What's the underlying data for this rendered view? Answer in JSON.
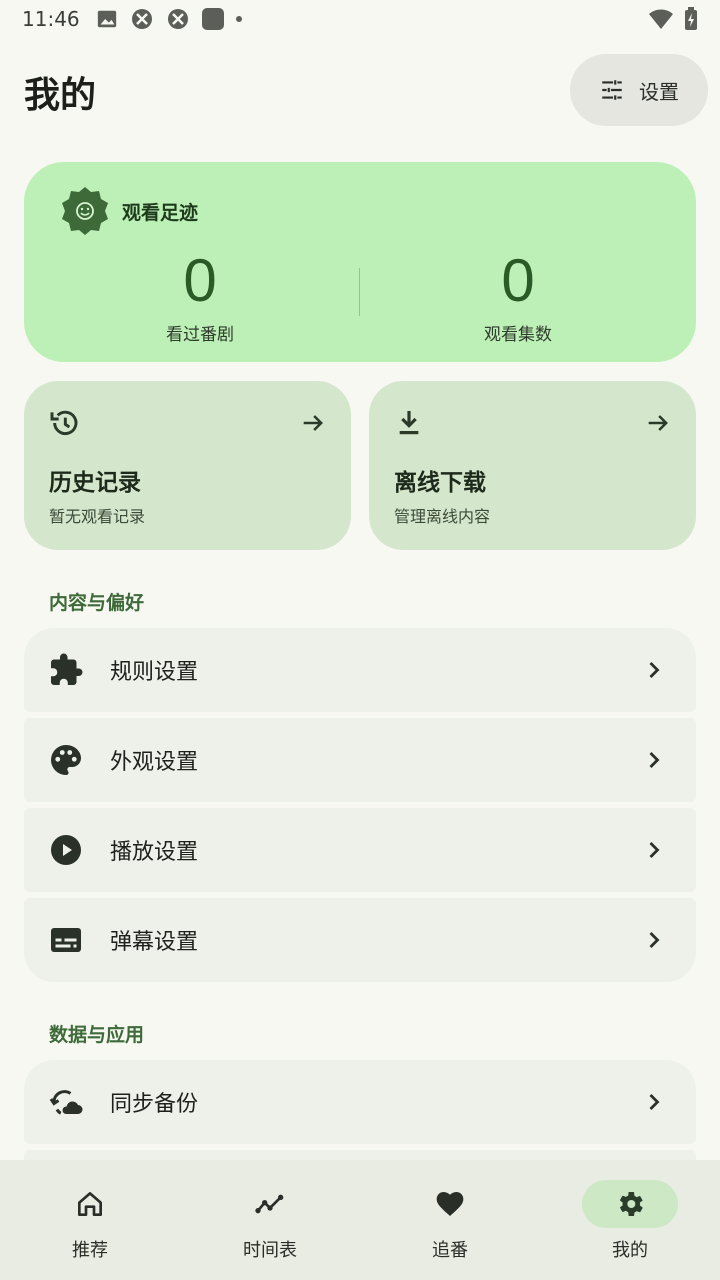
{
  "status_bar": {
    "time": "11:46",
    "left_icons": [
      "image-icon",
      "app-icon",
      "app-icon",
      "app-icon",
      "dot-icon"
    ],
    "right_icons": [
      "wifi-icon",
      "battery-charging-icon"
    ]
  },
  "header": {
    "title": "我的",
    "settings_label": "设置",
    "settings_icon": "tune-icon"
  },
  "stats": {
    "title": "观看足迹",
    "icon": "smile-badge-icon",
    "watched_shows_value": "0",
    "watched_shows_label": "看过番剧",
    "watched_episodes_value": "0",
    "watched_episodes_label": "观看集数"
  },
  "quick_cards": [
    {
      "icon": "history-icon",
      "title": "历史记录",
      "subtitle": "暂无观看记录"
    },
    {
      "icon": "download-icon",
      "title": "离线下载",
      "subtitle": "管理离线内容"
    }
  ],
  "section_content": {
    "title": "内容与偏好",
    "items": [
      {
        "icon": "puzzle-icon",
        "label": "规则设置"
      },
      {
        "icon": "palette-icon",
        "label": "外观设置"
      },
      {
        "icon": "play-circle-icon",
        "label": "播放设置"
      },
      {
        "icon": "subtitles-icon",
        "label": "弹幕设置"
      }
    ]
  },
  "section_data": {
    "title": "数据与应用",
    "items": [
      {
        "icon": "cloud-sync-icon",
        "label": "同步备份"
      }
    ]
  },
  "bottom_nav": {
    "items": [
      {
        "icon": "home-icon",
        "label": "推荐"
      },
      {
        "icon": "timeline-icon",
        "label": "时间表"
      },
      {
        "icon": "heart-icon",
        "label": "追番"
      },
      {
        "icon": "gear-icon",
        "label": "我的"
      }
    ],
    "active_index": 3
  },
  "colors": {
    "background": "#f6f8f1",
    "stats_card": "#bdf0b6",
    "quick_card": "#d4e7cc",
    "section_title": "#3e6a3a",
    "row_background": "#eef1e9",
    "nav_active_pill": "#cde8c4"
  }
}
